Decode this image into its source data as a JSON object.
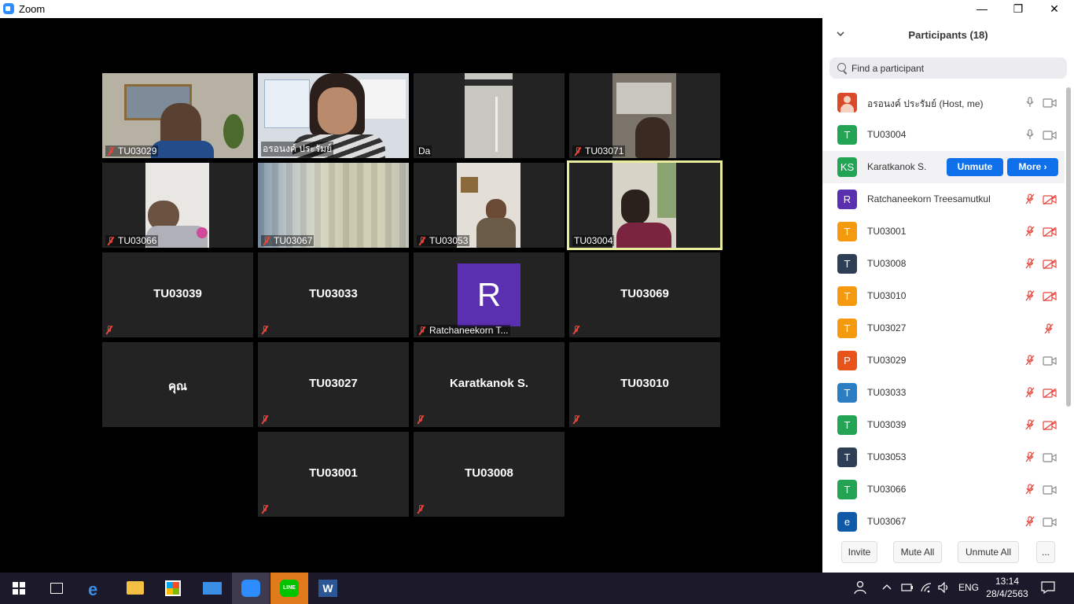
{
  "window": {
    "title": "Zoom",
    "minimize": "—",
    "restore": "❐",
    "close": "✕"
  },
  "gallery": {
    "tiles": [
      {
        "name": "TU03029",
        "muted": true
      },
      {
        "name": "อรอนงค์ ประรัมย์",
        "muted": false
      },
      {
        "name": "Da",
        "muted": false
      },
      {
        "name": "TU03071",
        "muted": true
      },
      {
        "name": "TU03066",
        "muted": true
      },
      {
        "name": "TU03067",
        "muted": true
      },
      {
        "name": "TU03053",
        "muted": true
      },
      {
        "name": "TU03004",
        "muted": false,
        "active_speaker": true
      },
      {
        "name": "TU03039",
        "muted": true
      },
      {
        "name": "TU03033",
        "muted": true
      },
      {
        "name": "Ratchaneekorn T...",
        "muted": true,
        "avatar_letter": "R"
      },
      {
        "name": "TU03069",
        "muted": true
      },
      {
        "name": "คุณ",
        "muted": false
      },
      {
        "name": "TU03027",
        "muted": true
      },
      {
        "name": "Karatkanok S.",
        "muted": true
      },
      {
        "name": "TU03010",
        "muted": true
      },
      {
        "name": "TU03001",
        "muted": true
      },
      {
        "name": "TU03008",
        "muted": true
      }
    ]
  },
  "participants": {
    "title": "Participants (18)",
    "collapse_icon": "chevron-down",
    "search_placeholder": "Find a participant",
    "unmute_label": "Unmute",
    "more_label": "More ›",
    "list": [
      {
        "initial": "",
        "name": "อรอนงค์ ประรัมย์ (Host, me)",
        "color": "#d94a2b",
        "mic": "on",
        "video": "on",
        "photo": true
      },
      {
        "initial": "T",
        "name": "TU03004",
        "color": "#23a455",
        "mic": "on",
        "video": "on"
      },
      {
        "initial": "KS",
        "name": "Karatkanok S.",
        "color": "#23a455",
        "mic": "none",
        "video": "none",
        "hover": true
      },
      {
        "initial": "R",
        "name": "Ratchaneekorn Treesamutkul",
        "color": "#5a2fb0",
        "mic": "muted",
        "video": "off"
      },
      {
        "initial": "T",
        "name": "TU03001",
        "color": "#f59a0e",
        "mic": "muted",
        "video": "off"
      },
      {
        "initial": "T",
        "name": "TU03008",
        "color": "#2e3e55",
        "mic": "muted",
        "video": "off"
      },
      {
        "initial": "T",
        "name": "TU03010",
        "color": "#f59a0e",
        "mic": "muted",
        "video": "off"
      },
      {
        "initial": "T",
        "name": "TU03027",
        "color": "#f59a0e",
        "mic": "none",
        "video": "muted-cam-slot"
      },
      {
        "initial": "P",
        "name": "TU03029",
        "color": "#e8531c",
        "mic": "muted",
        "video": "on"
      },
      {
        "initial": "T",
        "name": "TU03033",
        "color": "#2b7ec2",
        "mic": "muted",
        "video": "off"
      },
      {
        "initial": "T",
        "name": "TU03039",
        "color": "#23a455",
        "mic": "muted",
        "video": "off"
      },
      {
        "initial": "T",
        "name": "TU03053",
        "color": "#2e3e55",
        "mic": "muted",
        "video": "on"
      },
      {
        "initial": "T",
        "name": "TU03066",
        "color": "#23a455",
        "mic": "muted",
        "video": "on"
      },
      {
        "initial": "e",
        "name": "TU03067",
        "color": "#0e5aa8",
        "mic": "muted",
        "video": "on"
      }
    ],
    "footer": {
      "invite": "Invite",
      "mute_all": "Mute All",
      "unmute_all": "Unmute All",
      "more": "..."
    }
  },
  "taskbar": {
    "apps": [
      "start",
      "task-view",
      "edge",
      "file-explorer",
      "store",
      "mail",
      "zoom",
      "line",
      "word"
    ],
    "lang": "ENG",
    "time": "13:14",
    "date": "28/4/2563"
  }
}
